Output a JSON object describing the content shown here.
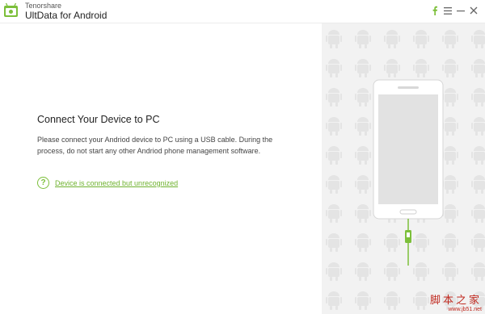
{
  "app": {
    "vendor": "Tenorshare",
    "title": "UltData for Android"
  },
  "window_controls": {
    "icons": [
      "facebook-icon",
      "menu-icon",
      "minimize-icon",
      "close-icon"
    ]
  },
  "main": {
    "heading": "Connect Your Device to PC",
    "description": "Please connect your Andriod device to PC using a USB cable. During the process, do not start any other Andriod phone management software.",
    "help_link": "Device is connected but unrecognized",
    "help_icon_glyph": "?"
  },
  "side_panel": {
    "watermark_main": "脚本之家",
    "watermark_sub": "www.jb51.net"
  },
  "colors": {
    "accent_green": "#7cbf3a",
    "link_green": "#6fb22f",
    "panel_bg": "#f2f2f2",
    "watermark_red": "#c0281e"
  }
}
